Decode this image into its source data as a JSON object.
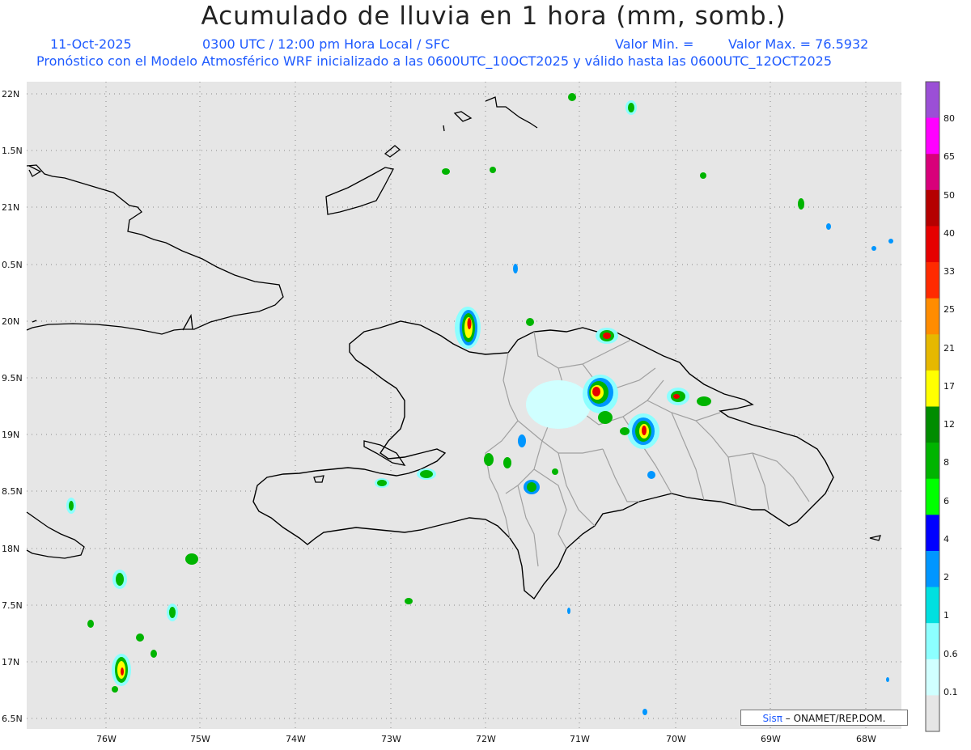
{
  "header": {
    "title": "Acumulado de lluvia en 1 hora (mm, somb.)",
    "date": "11-Oct-2025",
    "time": "0300 UTC / 12:00 pm Hora Local / SFC",
    "valor_min": "Valor Min. =",
    "valor_max": "Valor Max. = 76.5932",
    "forecast": "Pronóstico con el Modelo Atmosférico WRF inicializado a las 0600UTC_10OCT2025 y válido hasta las  0600UTC_12OCT2025"
  },
  "map": {
    "lat_labels": [
      "22N",
      "1.5N",
      "21N",
      "0.5N",
      "20N",
      "9.5N",
      "19N",
      "8.5N",
      "18N",
      "7.5N",
      "17N",
      "6.5N"
    ],
    "lon_labels": [
      "76W",
      "75W",
      "74W",
      "73W",
      "72W",
      "71W",
      "70W",
      "69W",
      "68W"
    ]
  },
  "colorbar": {
    "labels": [
      "80",
      "65",
      "50",
      "40",
      "33",
      "25",
      "21",
      "17",
      "12",
      "8",
      "6",
      "4",
      "2",
      "1",
      "0.6",
      "0.1"
    ],
    "colors": [
      "#9b4fd6",
      "#ff00ff",
      "#d8007a",
      "#b50000",
      "#e60000",
      "#ff2a00",
      "#ff8c00",
      "#e6b800",
      "#ffff00",
      "#008c00",
      "#00b400",
      "#00ff00",
      "#0000ff",
      "#0096ff",
      "#00e0e0",
      "#8cffff",
      "#d0ffff",
      "#e6e6e6"
    ]
  },
  "credit": {
    "brand": "Sisπ",
    "text": "– ONAMET/REP.DOM."
  },
  "colors": {
    "header_blue": "#1e5aff",
    "map_bg": "#e6e6e6",
    "coast": "#000000",
    "provinces": "#a0a0a0"
  }
}
